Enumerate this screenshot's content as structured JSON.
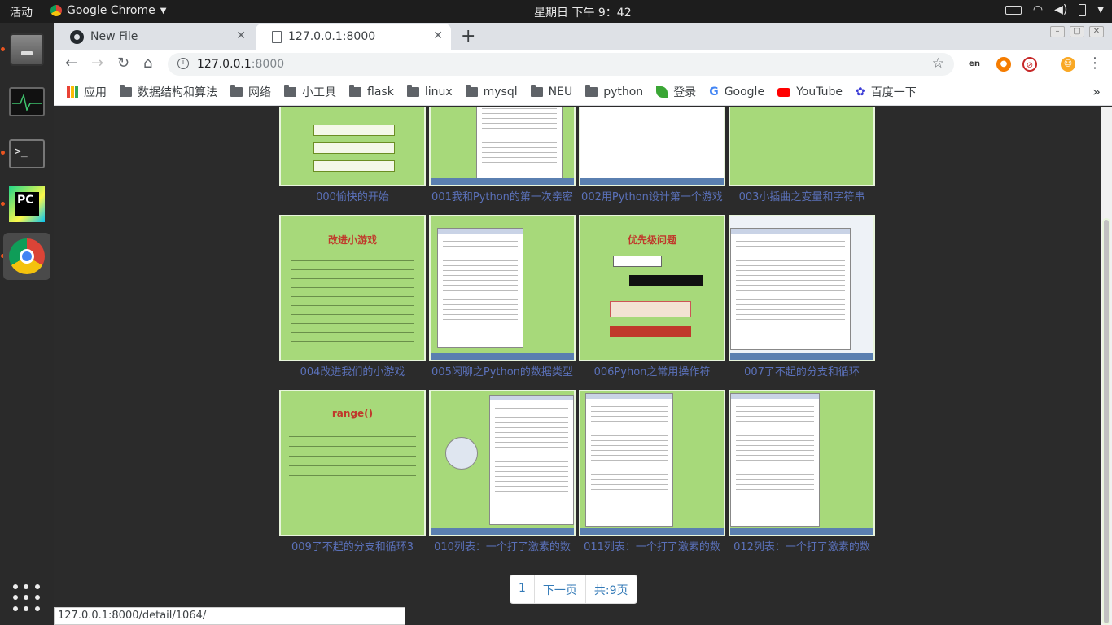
{
  "topbar": {
    "activities": "活动",
    "app_name": "Google Chrome",
    "clock": "星期日 下午 9：42"
  },
  "tabs": [
    {
      "title": "New File",
      "icon": "github-icon"
    },
    {
      "title": "127.0.0.1:8000",
      "icon": "page-icon"
    }
  ],
  "omnibox": {
    "host": "127.0.0.1",
    "port": ":8000"
  },
  "bookmarks": {
    "apps": "应用",
    "items": [
      "数据结构和算法",
      "网络",
      "小工具",
      "flask",
      "linux",
      "mysql",
      "NEU",
      "python"
    ],
    "login": "登录",
    "google": "Google",
    "youtube": "YouTube",
    "baidu": "百度一下"
  },
  "videos": [
    {
      "title": "000愉快的开始"
    },
    {
      "title": "001我和Python的第一次亲密"
    },
    {
      "title": "002用Python设计第一个游戏"
    },
    {
      "title": "003小插曲之变量和字符串"
    },
    {
      "title": "004改进我们的小游戏",
      "slide_title": "改进小游戏"
    },
    {
      "title": "005闲聊之Python的数据类型"
    },
    {
      "title": "006Pyhon之常用操作符",
      "slide_title": "优先级问题"
    },
    {
      "title": "007了不起的分支和循环"
    },
    {
      "title": "009了不起的分支和循环3",
      "slide_title": "range()"
    },
    {
      "title": "010列表：一个打了激素的数"
    },
    {
      "title": "011列表：一个打了激素的数"
    },
    {
      "title": "012列表：一个打了激素的数"
    }
  ],
  "pagination": {
    "current": "1",
    "next": "下一页",
    "total": "共:9页"
  },
  "status_url": "127.0.0.1:8000/detail/1064/"
}
